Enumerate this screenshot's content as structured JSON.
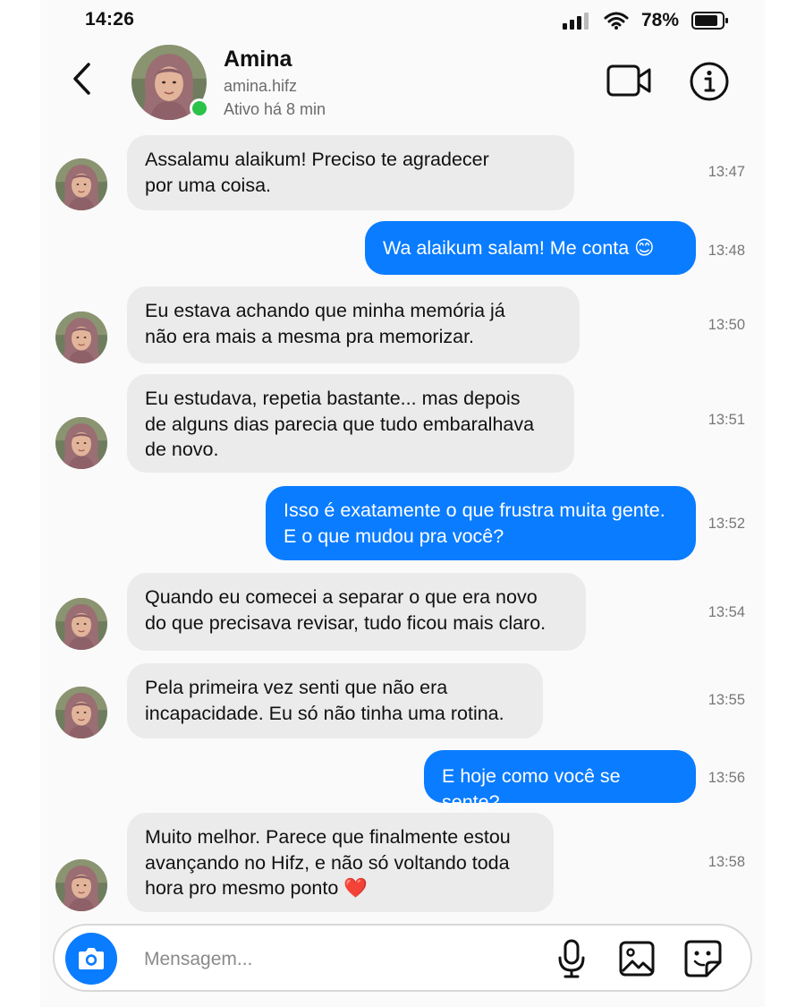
{
  "status": {
    "time": "14:26",
    "battery": "78%"
  },
  "header": {
    "name": "Amina",
    "username": "amina.hifz",
    "active": "Ativo há 8 min"
  },
  "messages": [
    {
      "from": "in",
      "text": "Assalamu alaikum! Preciso te agradecer\npor uma coisa.",
      "time": "13:47"
    },
    {
      "from": "out",
      "text": "Wa alaikum salam! Me conta 😊",
      "time": "13:48"
    },
    {
      "from": "in",
      "text": "Eu estava achando que minha memória já\nnão era mais a mesma pra memorizar.",
      "time": "13:50"
    },
    {
      "from": "in",
      "text": "Eu estudava, repetia bastante... mas depois\nde alguns dias parecia que tudo embaralhava\nde novo.",
      "time": "13:51"
    },
    {
      "from": "out",
      "text": "Isso é exatamente o que frustra muita gente.\nE o que mudou pra você?",
      "time": "13:52"
    },
    {
      "from": "in",
      "text": "Quando eu comecei a separar o que era novo\ndo que precisava revisar, tudo ficou mais claro.",
      "time": "13:54"
    },
    {
      "from": "in",
      "text": "Pela primeira vez senti que não era\nincapacidade. Eu só não tinha uma rotina.",
      "time": "13:55"
    },
    {
      "from": "out",
      "text": "E hoje como você se sente?",
      "time": "13:56"
    },
    {
      "from": "in",
      "text": "Muito melhor. Parece que finalmente estou\navançando no Hifz, e não só voltando toda\nhora pro mesmo ponto ❤️",
      "time": "13:58"
    }
  ],
  "composer": {
    "placeholder": "Mensagem..."
  },
  "colors": {
    "outgoing_bubble": "#0a7cff",
    "incoming_bubble": "#ebebeb",
    "online_dot": "#2bc24a"
  }
}
